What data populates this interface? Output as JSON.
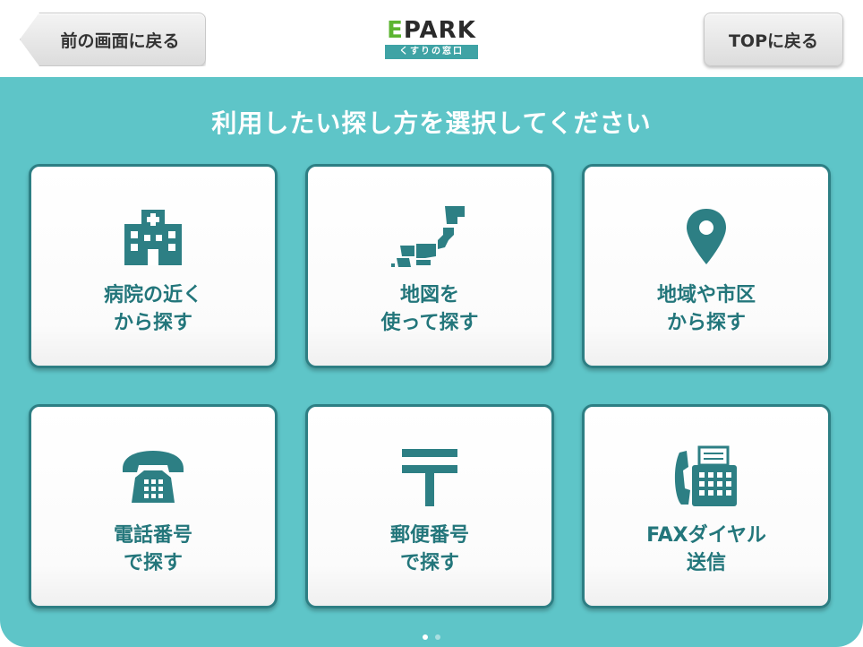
{
  "header": {
    "back_label": "前の画面に戻る",
    "top_label": "TOPに戻る",
    "logo_main": "PARK",
    "logo_e": "E",
    "logo_sub": "くすりの窓口"
  },
  "main": {
    "title": "利用したい探し方を選択してください",
    "options": [
      {
        "line1": "病院の近く",
        "line2": "から探す",
        "icon": "hospital-icon"
      },
      {
        "line1": "地図を",
        "line2": "使って探す",
        "icon": "japan-map-icon"
      },
      {
        "line1": "地域や市区",
        "line2": "から探す",
        "icon": "location-pin-icon"
      },
      {
        "line1": "電話番号",
        "line2": "で探す",
        "icon": "telephone-icon"
      },
      {
        "line1": "郵便番号",
        "line2": "で探す",
        "icon": "postal-mark-icon"
      },
      {
        "line1": "FAXダイヤル",
        "line2": "送信",
        "icon": "fax-icon"
      }
    ]
  },
  "pager": {
    "pages": 2,
    "current": 1
  },
  "colors": {
    "accent": "#5ec5c8",
    "icon": "#2d7f84",
    "label": "#23767b",
    "logo_green": "#5cb531",
    "logo_bar": "#3fa3a5"
  }
}
